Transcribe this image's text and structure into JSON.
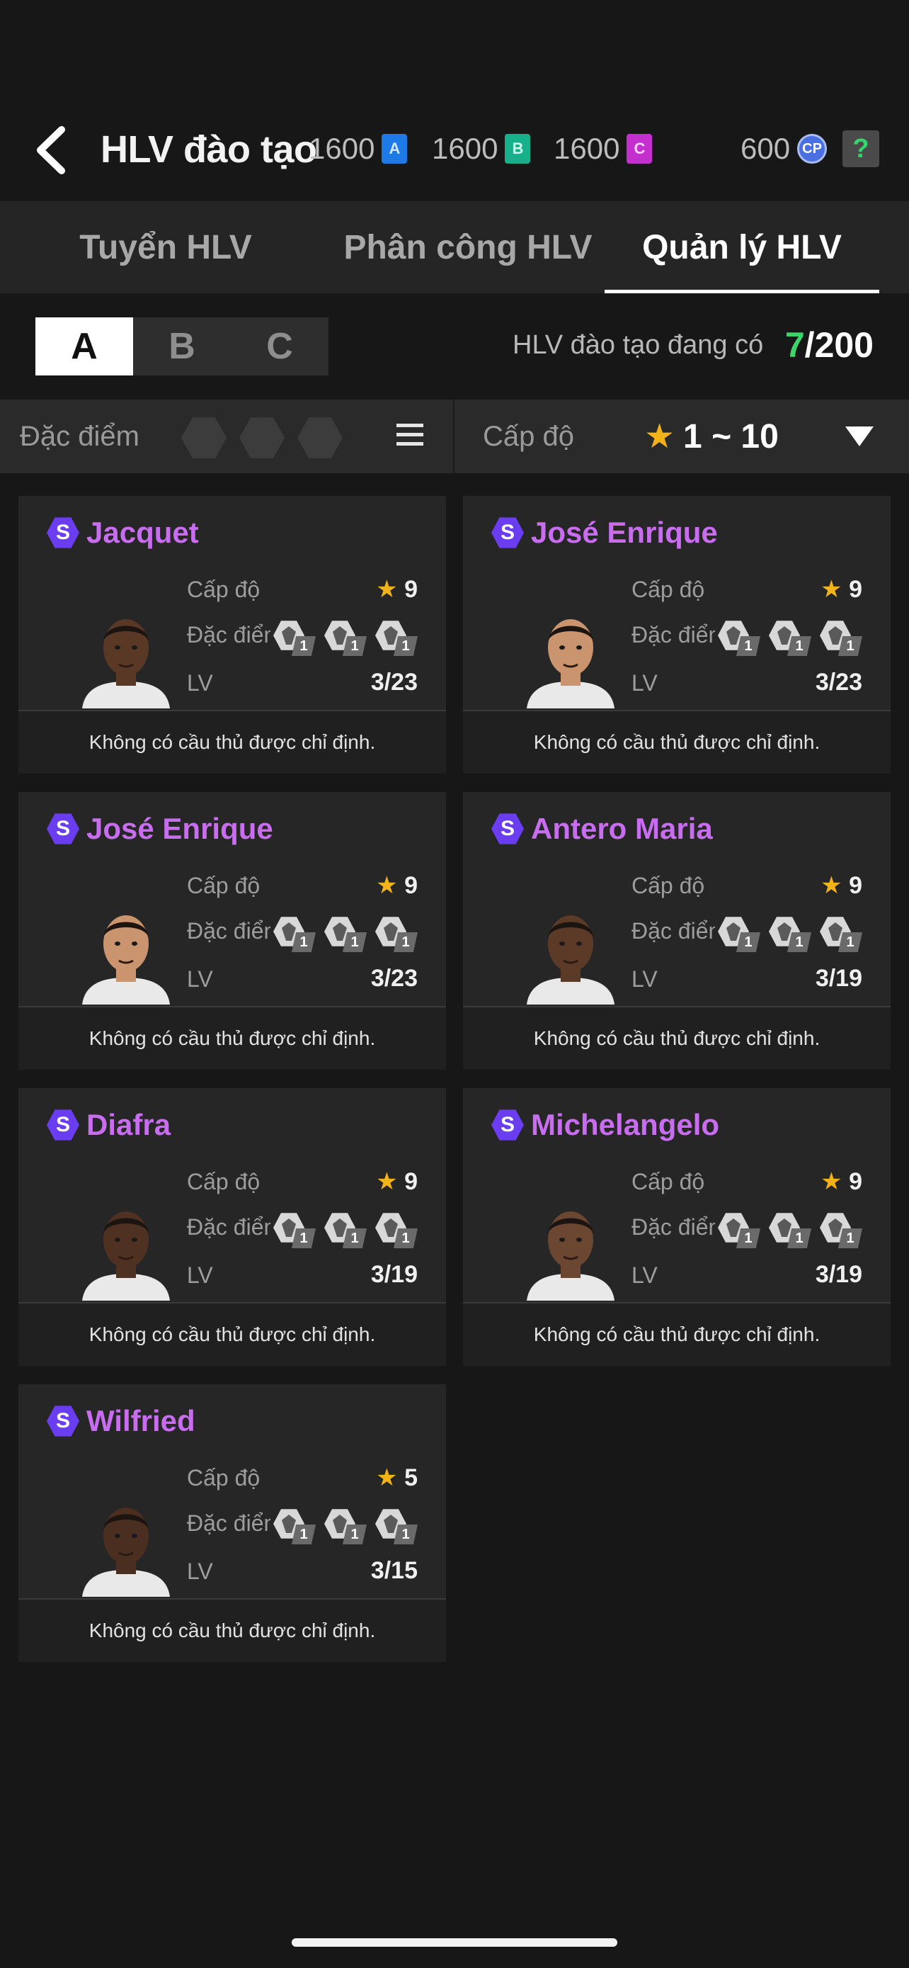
{
  "header": {
    "title": "HLV đào tạo",
    "currencies": [
      {
        "amount": "1600",
        "letter": "A",
        "color": "#1e7ae6"
      },
      {
        "amount": "1600",
        "letter": "B",
        "color": "#17b08a"
      },
      {
        "amount": "1600",
        "letter": "C",
        "color": "#c42fd0"
      }
    ],
    "cp": {
      "amount": "600",
      "label": "CP"
    },
    "help": "?"
  },
  "tabs": [
    "Tuyển HLV",
    "Phân công  HLV",
    "Quản lý HLV"
  ],
  "segments": [
    "A",
    "B",
    "C"
  ],
  "count": {
    "label": "HLV đào tạo đang có",
    "current": "7",
    "total": "/200"
  },
  "filter": {
    "trait_label": "Đặc điểm c",
    "level_label": "Cấp độ",
    "level_range": "1 ~ 10"
  },
  "card_labels": {
    "level": "Cấp độ",
    "trait": "Đặc điểm",
    "lv": "LV",
    "badge": "S"
  },
  "coaches": [
    {
      "name": "Jacquet",
      "level": "9",
      "lv": "3/23",
      "trait_levels": [
        "1",
        "1",
        "1"
      ],
      "footer": "Không có cầu thủ được chỉ định.",
      "skin": "#5a3826"
    },
    {
      "name": "José Enrique",
      "level": "9",
      "lv": "3/23",
      "trait_levels": [
        "1",
        "1",
        "1"
      ],
      "footer": "Không có cầu thủ được chỉ định.",
      "skin": "#c9946e"
    },
    {
      "name": "José Enrique",
      "level": "9",
      "lv": "3/23",
      "trait_levels": [
        "1",
        "1",
        "1"
      ],
      "footer": "Không có cầu thủ được chỉ định.",
      "skin": "#c9946e"
    },
    {
      "name": "Antero Maria",
      "level": "9",
      "lv": "3/19",
      "trait_levels": [
        "1",
        "1",
        "1"
      ],
      "footer": "Không có cầu thủ được chỉ định.",
      "skin": "#5b3a27"
    },
    {
      "name": "Diafra",
      "level": "9",
      "lv": "3/19",
      "trait_levels": [
        "1",
        "1",
        "1"
      ],
      "footer": "Không có cầu thủ được chỉ định.",
      "skin": "#4f3122"
    },
    {
      "name": "Michelangelo",
      "level": "9",
      "lv": "3/19",
      "trait_levels": [
        "1",
        "1",
        "1"
      ],
      "footer": "Không có cầu thủ được chỉ định.",
      "skin": "#6b4631"
    },
    {
      "name": "Wilfried",
      "level": "5",
      "lv": "3/15",
      "trait_levels": [
        "1",
        "1",
        "1"
      ],
      "footer": "Không có cầu thủ được chỉ định.",
      "skin": "#4a2e20"
    }
  ]
}
